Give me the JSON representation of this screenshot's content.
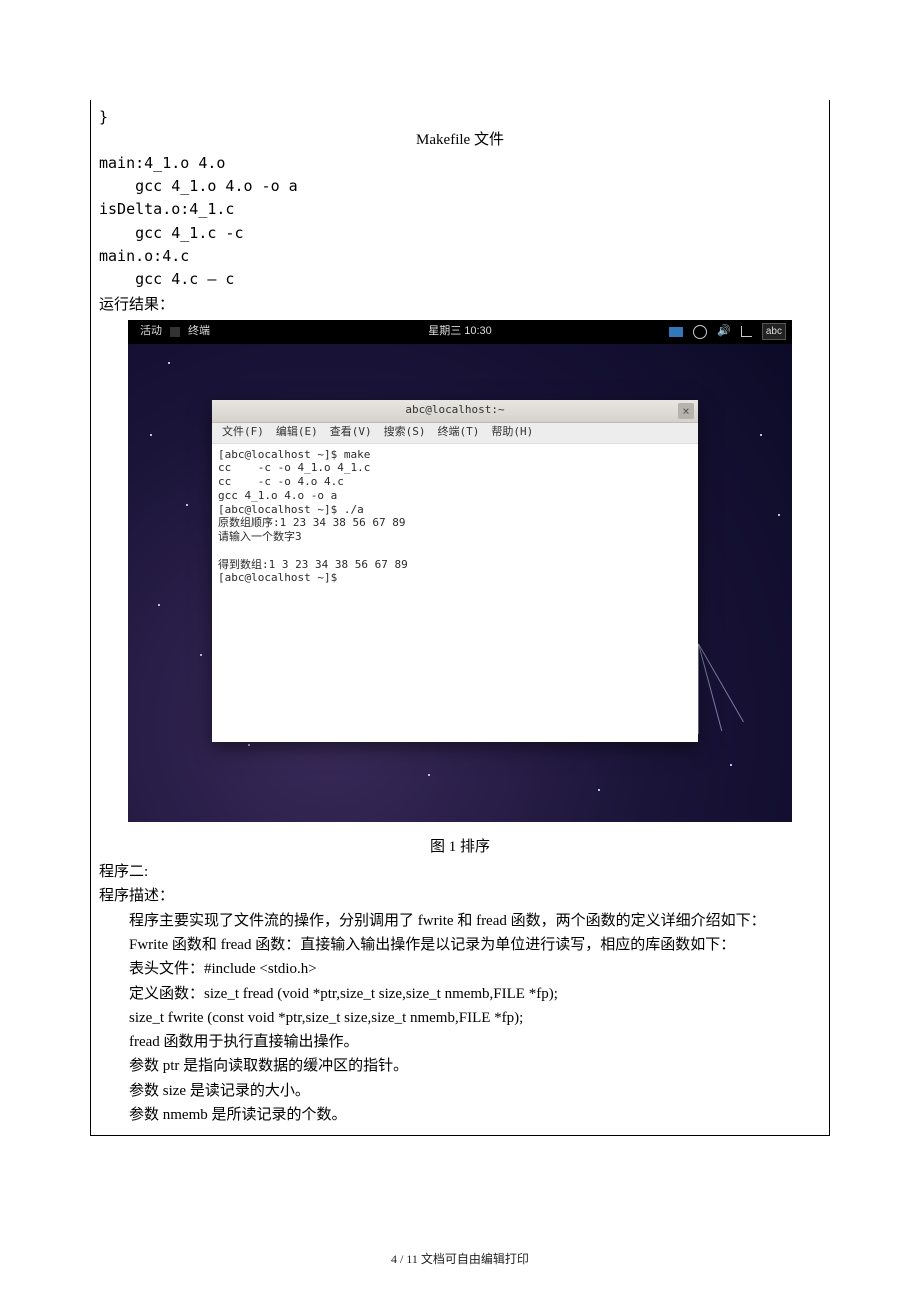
{
  "code_brace": "}",
  "mf_title": "Makefile 文件",
  "makefile": {
    "l1": "main:4_1.o 4.o",
    "l2": "    gcc 4_1.o 4.o -o a",
    "l3": "isDelta.o:4_1.c",
    "l4": "    gcc 4_1.c -c",
    "l5": "main.o:4.c",
    "l6": "    gcc 4.c – c"
  },
  "run_label": "运行结果：",
  "topbar": {
    "activities": "活动",
    "app": "终端",
    "clock": "星期三 10:30",
    "ime": "abc"
  },
  "terminal": {
    "title": "abc@localhost:~",
    "menu": {
      "file": "文件(F)",
      "edit": "编辑(E)",
      "view": "查看(V)",
      "search": "搜索(S)",
      "terminal": "终端(T)",
      "help": "帮助(H)"
    },
    "lines": {
      "l1": "[abc@localhost ~]$ make",
      "l2": "cc    -c -o 4_1.o 4_1.c",
      "l3": "cc    -c -o 4.o 4.c",
      "l4": "gcc 4_1.o 4.o -o a",
      "l5": "[abc@localhost ~]$ ./a",
      "l6": "原数组顺序:1 23 34 38 56 67 89",
      "l7": "请输入一个数字3",
      "l8": "",
      "l9": "得到数组:1 3 23 34 38 56 67 89",
      "l10": "[abc@localhost ~]$"
    }
  },
  "caption": "图 1   排序",
  "body": {
    "p1": "程序二:",
    "p2": "程序描述：",
    "p3": "程序主要实现了文件流的操作，分别调用了 fwrite 和 fread 函数，两个函数的定义详细介绍如下：",
    "p4": "Fwrite 函数和 fread 函数：直接输入输出操作是以记录为单位进行读写，相应的库函数如下：",
    "p5": "表头文件：#include <stdio.h>",
    "p6": "定义函数：size_t fread (void *ptr,size_t size,size_t nmemb,FILE *fp);",
    "p7": "size_t fwrite (const void *ptr,size_t size,size_t nmemb,FILE *fp);",
    "p8": "fread 函数用于执行直接输出操作。",
    "p9": "参数 ptr 是指向读取数据的缓冲区的指针。",
    "p10": "参数 size 是读记录的大小。",
    "p11": "参数 nmemb 是所读记录的个数。"
  },
  "footer": "4 / 11 文档可自由编辑打印"
}
